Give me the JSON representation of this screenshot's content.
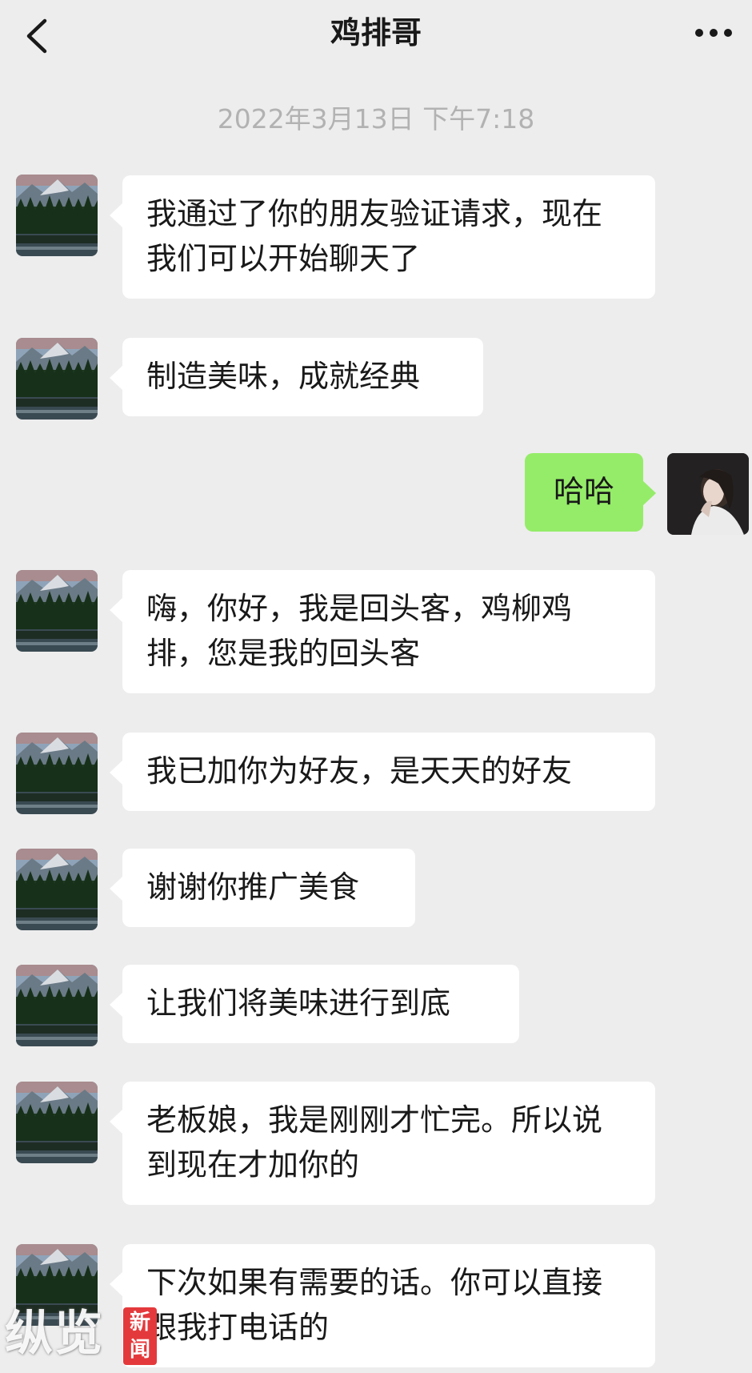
{
  "header": {
    "title": "鸡排哥",
    "back_icon": "chevron-left-icon",
    "more_icon": "more-dots-icon"
  },
  "timestamp": "2022年3月13日 下午7:18",
  "messages": [
    {
      "side": "left",
      "text": "我通过了你的朋友验证请求，现在我们可以开始聊天了"
    },
    {
      "side": "left",
      "text": "制造美味，成就经典"
    },
    {
      "side": "right",
      "text": "哈哈"
    },
    {
      "side": "left",
      "text": "嗨，你好，我是回头客，鸡柳鸡排，您是我的回头客"
    },
    {
      "side": "left",
      "text": "我已加你为好友，是天天的好友"
    },
    {
      "side": "left",
      "text": "谢谢你推广美食"
    },
    {
      "side": "left",
      "text": "让我们将美味进行到底"
    },
    {
      "side": "left",
      "text": "老板娘，我是刚刚才忙完。所以说到现在才加你的"
    },
    {
      "side": "left",
      "text": "下次如果有需要的话。你可以直接跟我打电话的"
    }
  ],
  "watermark": {
    "brand": "纵览",
    "badge": "新闻"
  },
  "colors": {
    "background": "#ededed",
    "incoming_bubble": "#ffffff",
    "outgoing_bubble": "#95ec69",
    "timestamp": "#b2b2b2"
  }
}
